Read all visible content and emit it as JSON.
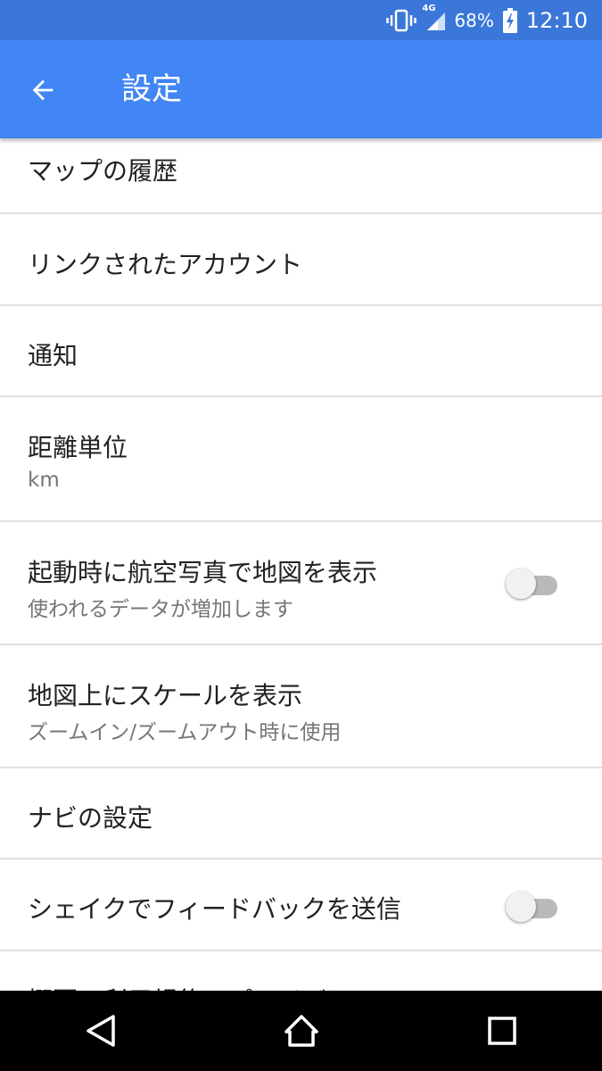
{
  "status_bar": {
    "network": "4G",
    "battery": "68%",
    "time": "12:10",
    "icons": [
      "vibrate-icon",
      "signal-icon",
      "battery-charging-icon"
    ]
  },
  "app_bar": {
    "title": "設定",
    "back_icon": "arrow-left-icon"
  },
  "settings": {
    "items": [
      {
        "label": "マップの履歴"
      },
      {
        "label": "リンクされたアカウント"
      },
      {
        "label": "通知"
      },
      {
        "label": "距離単位",
        "sub": "km"
      },
      {
        "label": "起動時に航空写真で地図を表示",
        "sub": "使われるデータが増加します",
        "toggle": false
      },
      {
        "label": "地図上にスケールを表示",
        "sub": "ズームイン/ズームアウト時に使用"
      },
      {
        "label": "ナビの設定"
      },
      {
        "label": "シェイクでフィードバックを送信",
        "toggle": false
      },
      {
        "label": "概要、利用規約、プライバシー"
      }
    ]
  },
  "nav_bar": {
    "icons": [
      "back-triangle-icon",
      "home-icon",
      "recents-square-icon"
    ]
  },
  "colors": {
    "app_bar": "#4285f4",
    "status_bar": "#3a77d8",
    "divider": "#e0e0e0",
    "primary_text": "#212121",
    "secondary_text": "#757575"
  }
}
